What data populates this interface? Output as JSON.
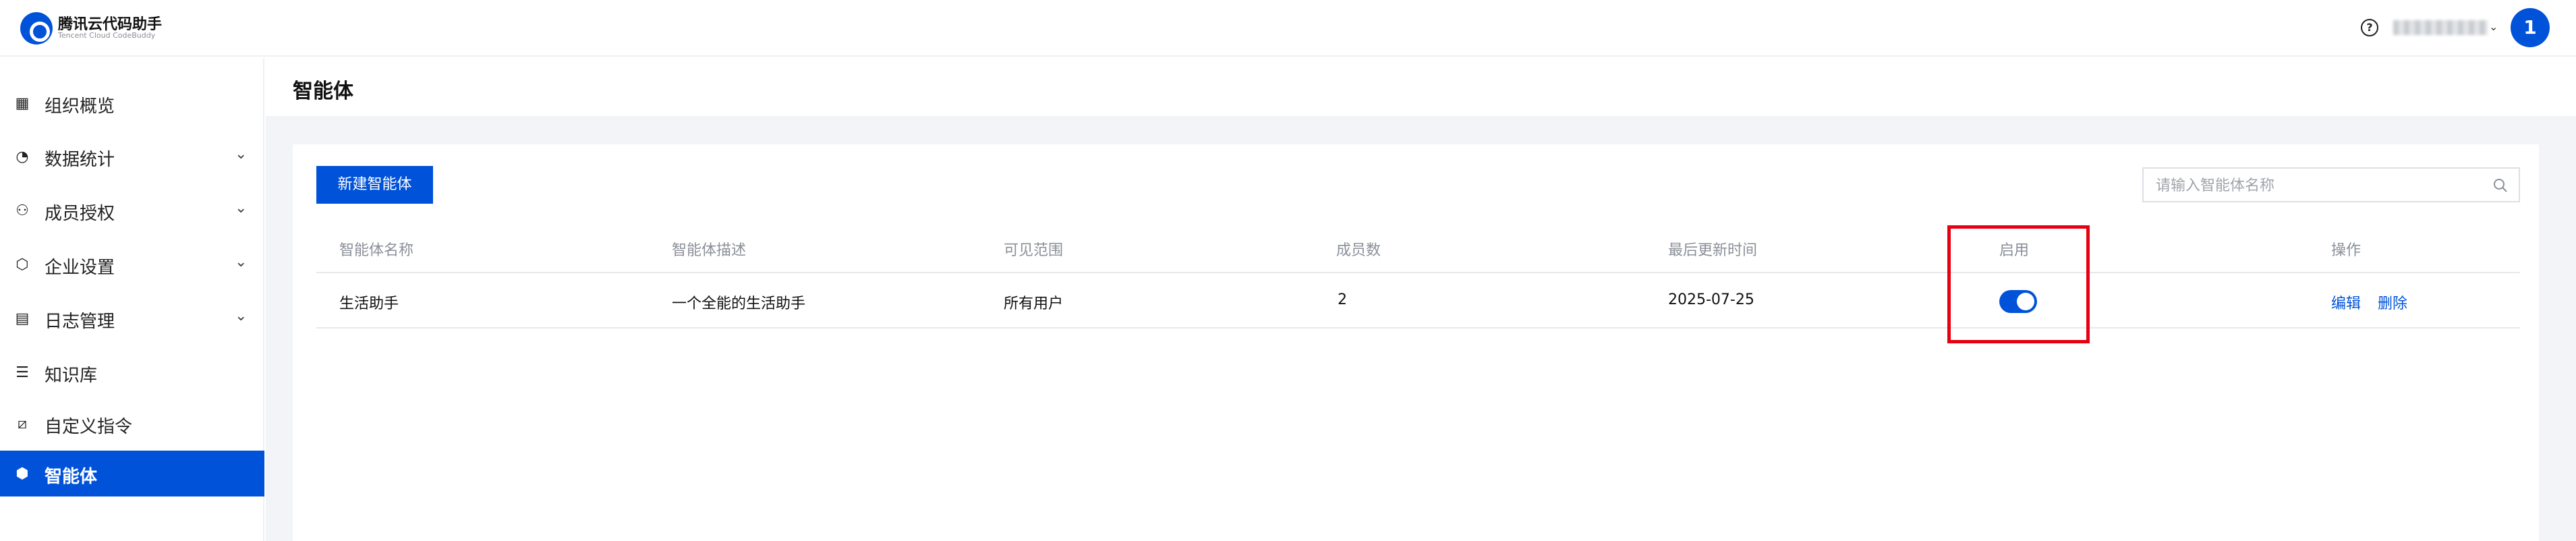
{
  "app": {
    "title": "腾讯云代码助手",
    "subtitle": "Tencent Cloud CodeBuddy",
    "avatar_text": "1",
    "accent_color": "#0052d9"
  },
  "header": {
    "help_icon": "question-circle-icon"
  },
  "sidebar": {
    "items": [
      {
        "label": "组织概览",
        "icon": "grid-icon",
        "has_chevron": false,
        "active": false
      },
      {
        "label": "数据统计",
        "icon": "pie-chart-icon",
        "has_chevron": true,
        "active": false
      },
      {
        "label": "成员授权",
        "icon": "user-icon",
        "has_chevron": true,
        "active": false
      },
      {
        "label": "企业设置",
        "icon": "settings-icon",
        "has_chevron": true,
        "active": false
      },
      {
        "label": "日志管理",
        "icon": "calendar-log-icon",
        "has_chevron": true,
        "active": false
      },
      {
        "label": "知识库",
        "icon": "database-icon",
        "has_chevron": false,
        "active": false
      },
      {
        "label": "自定义指令",
        "icon": "slash-command-icon",
        "has_chevron": false,
        "active": false
      },
      {
        "label": "智能体",
        "icon": "cube-icon",
        "has_chevron": false,
        "active": true
      }
    ]
  },
  "main": {
    "page_title": "智能体",
    "new_button_label": "新建智能体",
    "search_placeholder": "请输入智能体名称",
    "table": {
      "columns": [
        "智能体名称",
        "智能体描述",
        "可见范围",
        "成员数",
        "最后更新时间",
        "启用",
        "操作"
      ],
      "rows": [
        {
          "name": "生活助手",
          "description": "一个全能的生活助手",
          "visibility": "所有用户",
          "members": "2",
          "updated": "2025-07-25",
          "enabled": true,
          "actions": [
            "编辑",
            "删除"
          ]
        }
      ]
    }
  }
}
